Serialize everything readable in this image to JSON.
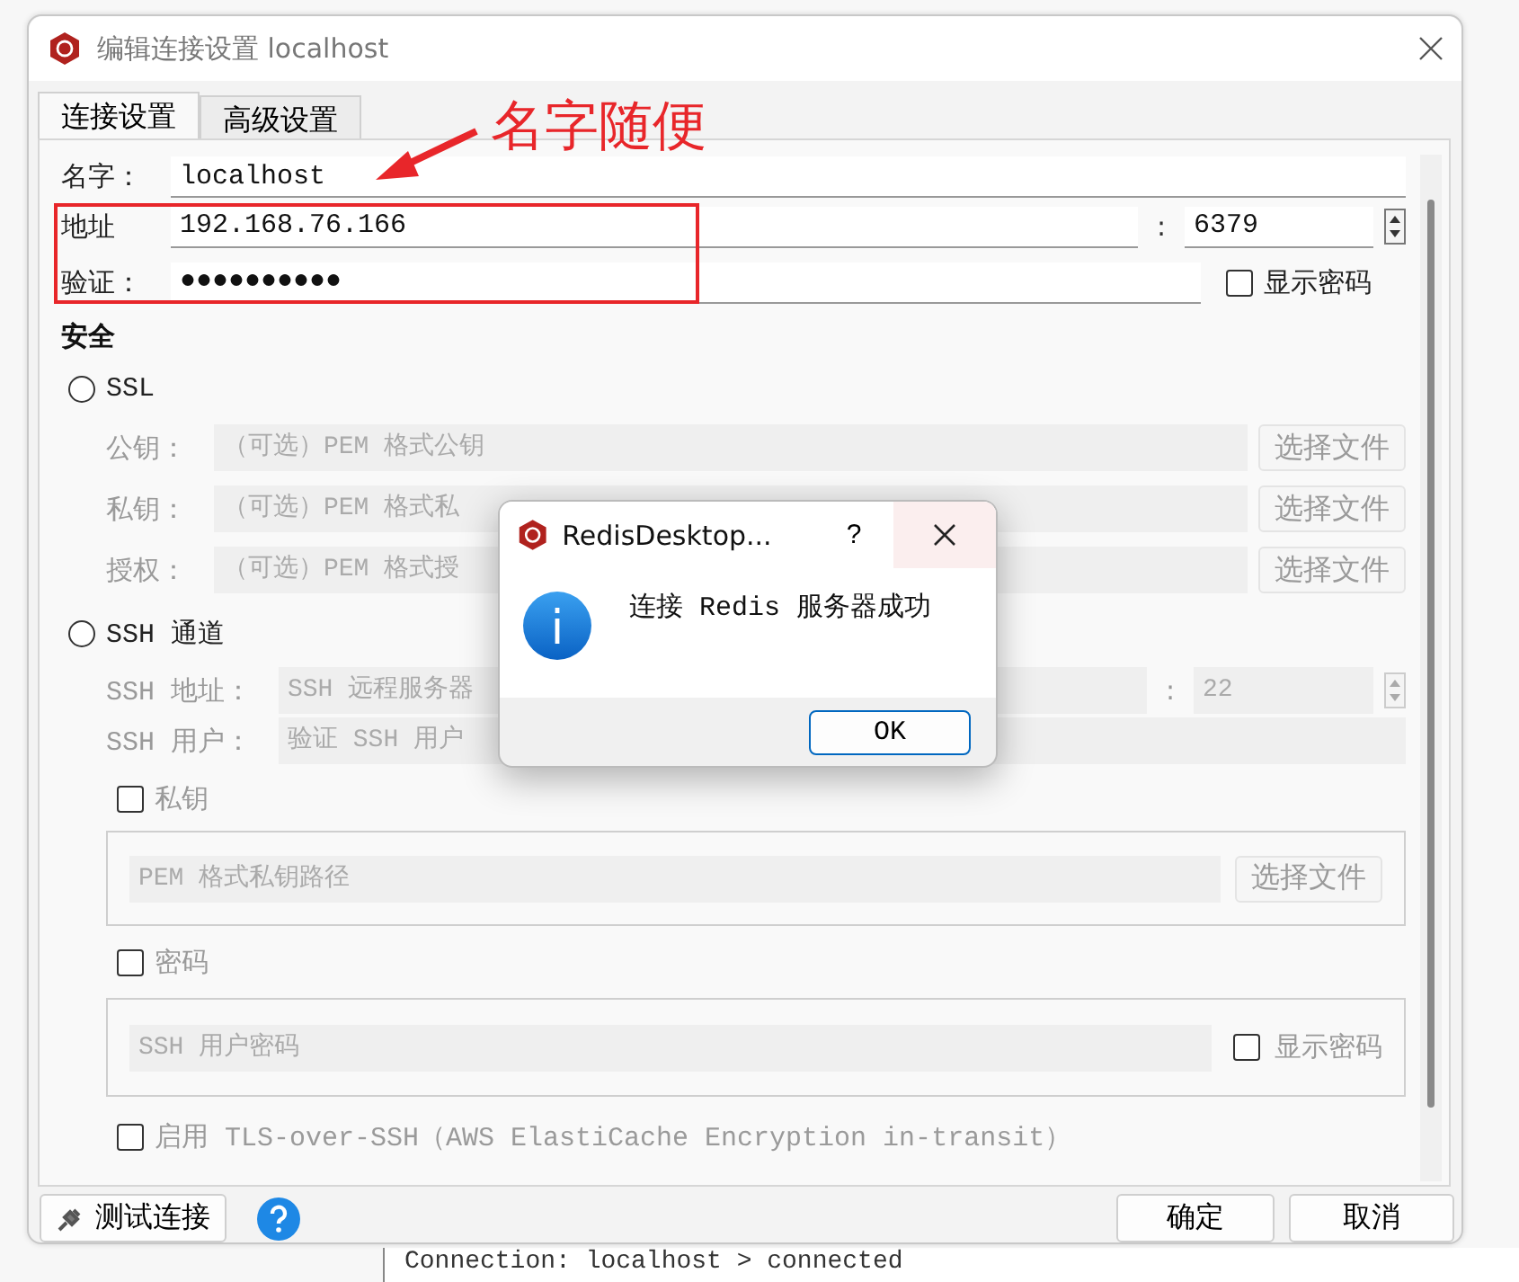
{
  "window": {
    "title": "编辑连接设置 localhost"
  },
  "tabs": [
    {
      "label": "连接设置",
      "selected": true
    },
    {
      "label": "高级设置",
      "selected": false
    }
  ],
  "connection": {
    "name": {
      "label": "名字：",
      "value": "localhost"
    },
    "address": {
      "label": "地址",
      "value": "192.168.76.166",
      "separator": ":",
      "port": "6379"
    },
    "auth": {
      "label": "验证：",
      "value": "●●●●●●●●●●",
      "show_password": {
        "label": "显示密码",
        "checked": false
      }
    }
  },
  "security": {
    "title": "安全",
    "ssl": {
      "label": "SSL",
      "selected": false,
      "rows": [
        {
          "label": "公钥：",
          "placeholder": "（可选）PEM 格式公钥",
          "button": "选择文件"
        },
        {
          "label": "私钥：",
          "placeholder": "（可选）PEM 格式私",
          "button": "选择文件"
        },
        {
          "label": "授权：",
          "placeholder": "（可选）PEM 格式授",
          "button": "选择文件"
        }
      ]
    },
    "ssh": {
      "label": "SSH 通道",
      "selected": false,
      "address": {
        "label": "SSH 地址：",
        "placeholder": "SSH 远程服务器",
        "separator": ":",
        "port_placeholder": "22"
      },
      "user": {
        "label": "SSH 用户：",
        "placeholder": "验证 SSH 用户"
      },
      "private_key": {
        "label": "私钥",
        "checked": false,
        "placeholder": "PEM 格式私钥路径",
        "button": "选择文件"
      },
      "password": {
        "label": "密码",
        "checked": false,
        "placeholder": "SSH 用户密码",
        "show_password": {
          "label": "显示密码",
          "checked": false
        }
      }
    },
    "tls": {
      "label": "启用 TLS-over-SSH（AWS ElastiCache Encryption in-transit）",
      "checked": false
    }
  },
  "footer": {
    "test_button": "测试连接",
    "buttons": [
      "确定",
      "取消"
    ]
  },
  "annotation": {
    "text": "名字随便"
  },
  "message_box": {
    "title": "RedisDesktop...",
    "help": "?",
    "text": "连接 Redis 服务器成功",
    "button": "OK"
  },
  "console": {
    "line": "Connection: localhost > connected"
  }
}
